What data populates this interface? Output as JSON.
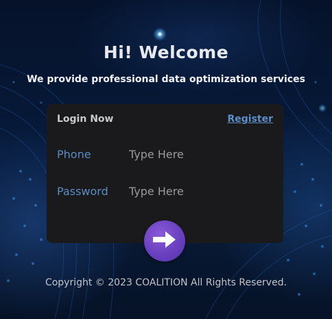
{
  "hero": {
    "title": "Hi! Welcome",
    "subtitle": "We provide professional data optimization services"
  },
  "login_card": {
    "title": "Login Now",
    "register_label": "Register",
    "fields": [
      {
        "label": "Phone",
        "placeholder": "Type Here",
        "value": ""
      },
      {
        "label": "Password",
        "placeholder": "Type Here",
        "value": ""
      }
    ]
  },
  "submit": {
    "icon": "arrow-right-icon",
    "color": "#6a40c0"
  },
  "footer": {
    "copyright": "Copyright © 2023 COALITION All Rights Reserved."
  },
  "colors": {
    "background": "#071a3a",
    "card": "#1a1a1c",
    "accent_link": "#5b8fc8",
    "button": "#6a40c0"
  }
}
